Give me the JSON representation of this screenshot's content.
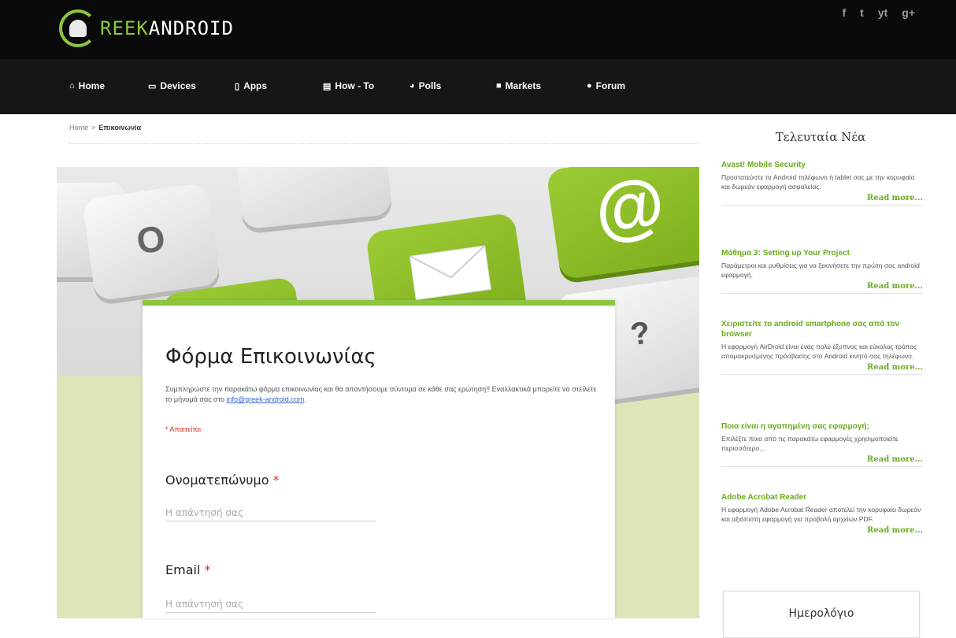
{
  "brand": {
    "logo_green": "REEK",
    "logo_white": "ANDROID",
    "accent": "#8cc63f"
  },
  "social": [
    "f",
    "t",
    "yt",
    "g+"
  ],
  "nav": [
    {
      "icon": "home-icon",
      "glyph": "⌂",
      "label": "Home"
    },
    {
      "icon": "devices-icon",
      "glyph": "▭",
      "label": "Devices"
    },
    {
      "icon": "apps-icon",
      "glyph": "▯",
      "label": "Apps"
    },
    {
      "icon": "howto-icon",
      "glyph": "▤",
      "label": "How - To"
    },
    {
      "icon": "polls-icon",
      "glyph": "◕",
      "label": "Polls"
    },
    {
      "icon": "markets-icon",
      "glyph": "■",
      "label": "Markets"
    },
    {
      "icon": "forum-icon",
      "glyph": "●",
      "label": "Forum"
    }
  ],
  "breadcrumb": {
    "home": "Home",
    "sep": ">",
    "current": "Επικοινωνία"
  },
  "hero": {
    "key_o": "O",
    "key_at": "@",
    "key_q": "?"
  },
  "form": {
    "title": "Φόρμα Επικοινωνίας",
    "desc_before": "Συμπληρώστε την παρακάτω φόρμα επικοινωνίας και θα απαντήσουμε σύντομα σε κάθε σας ερώτηση!! Εναλλακτικά μπορείτε να στείλετε το μήνυμά σας στο ",
    "desc_email": "info@greek-android.com",
    "desc_after": ".",
    "required": "* Απαιτείται",
    "q1_label": "Ονοματεπώνυμο",
    "q2_label": "Email",
    "star": "*",
    "placeholder": "Η απάντησή σας"
  },
  "sidebar": {
    "title": "Τελευταία Νέα",
    "read_more": "Read more...",
    "news": [
      {
        "title": "Avast! Mobile Security",
        "text": "Προστατεύστε το Android τηλέφωνο ή tablet σας με την κορυφαία και δωρεάν εφαρμογή ασφαλείας."
      },
      {
        "title": "Μάθημα 3: Setting up Your Project",
        "text": "Παράμετροι και ρυθμίσεις για να ξεκινήσετε την πρώτη σας android εφαρμογή."
      },
      {
        "title": "Χειριστείτε το android smartphone σας από τον browser",
        "text": "Η εφαρμογή AirDroid είναι ένας πολύ έξυπνος και εύκολος τρόπος απομακρυσμένης πρόσβασης στο Android κινητό σας τηλέφωνο."
      },
      {
        "title": "Ποια είναι η αγαπημένη σας εφαρμογή;",
        "text": "Επιλέξτε ποια από τις παρακάτω εφαρμογές χρησιμοποιείτε περισσότερο..."
      },
      {
        "title": "Adobe Acrobat Reader",
        "text": "Η εφαρμογή Adobe Acrobat Reader αποτελεί την κορυφαία δωρεάν και αξιόπιστη εφαρμογή για προβολή αρχείων PDF."
      }
    ],
    "calendar_title": "Ημερολόγιο"
  }
}
